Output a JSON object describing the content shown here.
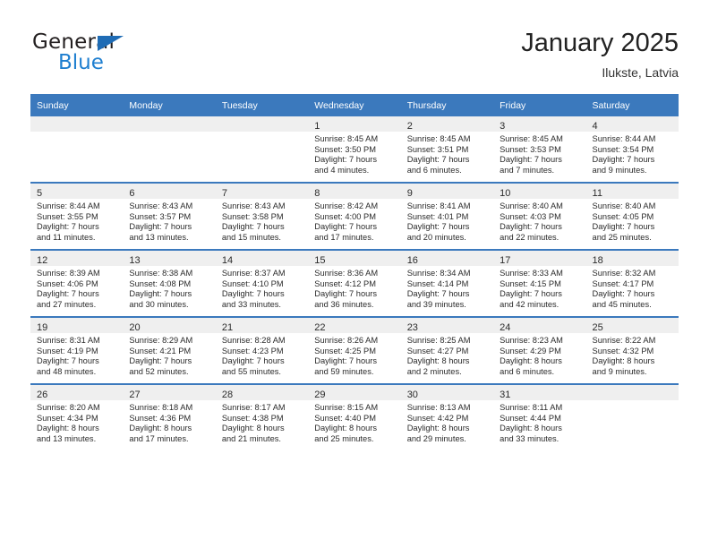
{
  "brand": {
    "name_part1": "General",
    "name_part2": "Blue",
    "triangle_color": "#1f6cb5",
    "blue_color": "#1f7fd0"
  },
  "header": {
    "title": "January 2025",
    "subtitle": "Ilukste, Latvia"
  },
  "theme": {
    "header_bg": "#3b79bd",
    "row_divider": "#3b79bd",
    "daynum_band": "#efefef"
  },
  "weekday_headers": [
    "Sunday",
    "Monday",
    "Tuesday",
    "Wednesday",
    "Thursday",
    "Friday",
    "Saturday"
  ],
  "labels": {
    "sunrise_prefix": "Sunrise:",
    "sunset_prefix": "Sunset:",
    "daylight_prefix": "Daylight:"
  },
  "weeks": [
    [
      {
        "empty": true
      },
      {
        "empty": true
      },
      {
        "empty": true
      },
      {
        "day": "1",
        "sunrise": "Sunrise: 8:45 AM",
        "sunset": "Sunset: 3:50 PM",
        "daylight_line1": "Daylight: 7 hours",
        "daylight_line2": "and 4 minutes."
      },
      {
        "day": "2",
        "sunrise": "Sunrise: 8:45 AM",
        "sunset": "Sunset: 3:51 PM",
        "daylight_line1": "Daylight: 7 hours",
        "daylight_line2": "and 6 minutes."
      },
      {
        "day": "3",
        "sunrise": "Sunrise: 8:45 AM",
        "sunset": "Sunset: 3:53 PM",
        "daylight_line1": "Daylight: 7 hours",
        "daylight_line2": "and 7 minutes."
      },
      {
        "day": "4",
        "sunrise": "Sunrise: 8:44 AM",
        "sunset": "Sunset: 3:54 PM",
        "daylight_line1": "Daylight: 7 hours",
        "daylight_line2": "and 9 minutes."
      }
    ],
    [
      {
        "day": "5",
        "sunrise": "Sunrise: 8:44 AM",
        "sunset": "Sunset: 3:55 PM",
        "daylight_line1": "Daylight: 7 hours",
        "daylight_line2": "and 11 minutes."
      },
      {
        "day": "6",
        "sunrise": "Sunrise: 8:43 AM",
        "sunset": "Sunset: 3:57 PM",
        "daylight_line1": "Daylight: 7 hours",
        "daylight_line2": "and 13 minutes."
      },
      {
        "day": "7",
        "sunrise": "Sunrise: 8:43 AM",
        "sunset": "Sunset: 3:58 PM",
        "daylight_line1": "Daylight: 7 hours",
        "daylight_line2": "and 15 minutes."
      },
      {
        "day": "8",
        "sunrise": "Sunrise: 8:42 AM",
        "sunset": "Sunset: 4:00 PM",
        "daylight_line1": "Daylight: 7 hours",
        "daylight_line2": "and 17 minutes."
      },
      {
        "day": "9",
        "sunrise": "Sunrise: 8:41 AM",
        "sunset": "Sunset: 4:01 PM",
        "daylight_line1": "Daylight: 7 hours",
        "daylight_line2": "and 20 minutes."
      },
      {
        "day": "10",
        "sunrise": "Sunrise: 8:40 AM",
        "sunset": "Sunset: 4:03 PM",
        "daylight_line1": "Daylight: 7 hours",
        "daylight_line2": "and 22 minutes."
      },
      {
        "day": "11",
        "sunrise": "Sunrise: 8:40 AM",
        "sunset": "Sunset: 4:05 PM",
        "daylight_line1": "Daylight: 7 hours",
        "daylight_line2": "and 25 minutes."
      }
    ],
    [
      {
        "day": "12",
        "sunrise": "Sunrise: 8:39 AM",
        "sunset": "Sunset: 4:06 PM",
        "daylight_line1": "Daylight: 7 hours",
        "daylight_line2": "and 27 minutes."
      },
      {
        "day": "13",
        "sunrise": "Sunrise: 8:38 AM",
        "sunset": "Sunset: 4:08 PM",
        "daylight_line1": "Daylight: 7 hours",
        "daylight_line2": "and 30 minutes."
      },
      {
        "day": "14",
        "sunrise": "Sunrise: 8:37 AM",
        "sunset": "Sunset: 4:10 PM",
        "daylight_line1": "Daylight: 7 hours",
        "daylight_line2": "and 33 minutes."
      },
      {
        "day": "15",
        "sunrise": "Sunrise: 8:36 AM",
        "sunset": "Sunset: 4:12 PM",
        "daylight_line1": "Daylight: 7 hours",
        "daylight_line2": "and 36 minutes."
      },
      {
        "day": "16",
        "sunrise": "Sunrise: 8:34 AM",
        "sunset": "Sunset: 4:14 PM",
        "daylight_line1": "Daylight: 7 hours",
        "daylight_line2": "and 39 minutes."
      },
      {
        "day": "17",
        "sunrise": "Sunrise: 8:33 AM",
        "sunset": "Sunset: 4:15 PM",
        "daylight_line1": "Daylight: 7 hours",
        "daylight_line2": "and 42 minutes."
      },
      {
        "day": "18",
        "sunrise": "Sunrise: 8:32 AM",
        "sunset": "Sunset: 4:17 PM",
        "daylight_line1": "Daylight: 7 hours",
        "daylight_line2": "and 45 minutes."
      }
    ],
    [
      {
        "day": "19",
        "sunrise": "Sunrise: 8:31 AM",
        "sunset": "Sunset: 4:19 PM",
        "daylight_line1": "Daylight: 7 hours",
        "daylight_line2": "and 48 minutes."
      },
      {
        "day": "20",
        "sunrise": "Sunrise: 8:29 AM",
        "sunset": "Sunset: 4:21 PM",
        "daylight_line1": "Daylight: 7 hours",
        "daylight_line2": "and 52 minutes."
      },
      {
        "day": "21",
        "sunrise": "Sunrise: 8:28 AM",
        "sunset": "Sunset: 4:23 PM",
        "daylight_line1": "Daylight: 7 hours",
        "daylight_line2": "and 55 minutes."
      },
      {
        "day": "22",
        "sunrise": "Sunrise: 8:26 AM",
        "sunset": "Sunset: 4:25 PM",
        "daylight_line1": "Daylight: 7 hours",
        "daylight_line2": "and 59 minutes."
      },
      {
        "day": "23",
        "sunrise": "Sunrise: 8:25 AM",
        "sunset": "Sunset: 4:27 PM",
        "daylight_line1": "Daylight: 8 hours",
        "daylight_line2": "and 2 minutes."
      },
      {
        "day": "24",
        "sunrise": "Sunrise: 8:23 AM",
        "sunset": "Sunset: 4:29 PM",
        "daylight_line1": "Daylight: 8 hours",
        "daylight_line2": "and 6 minutes."
      },
      {
        "day": "25",
        "sunrise": "Sunrise: 8:22 AM",
        "sunset": "Sunset: 4:32 PM",
        "daylight_line1": "Daylight: 8 hours",
        "daylight_line2": "and 9 minutes."
      }
    ],
    [
      {
        "day": "26",
        "sunrise": "Sunrise: 8:20 AM",
        "sunset": "Sunset: 4:34 PM",
        "daylight_line1": "Daylight: 8 hours",
        "daylight_line2": "and 13 minutes."
      },
      {
        "day": "27",
        "sunrise": "Sunrise: 8:18 AM",
        "sunset": "Sunset: 4:36 PM",
        "daylight_line1": "Daylight: 8 hours",
        "daylight_line2": "and 17 minutes."
      },
      {
        "day": "28",
        "sunrise": "Sunrise: 8:17 AM",
        "sunset": "Sunset: 4:38 PM",
        "daylight_line1": "Daylight: 8 hours",
        "daylight_line2": "and 21 minutes."
      },
      {
        "day": "29",
        "sunrise": "Sunrise: 8:15 AM",
        "sunset": "Sunset: 4:40 PM",
        "daylight_line1": "Daylight: 8 hours",
        "daylight_line2": "and 25 minutes."
      },
      {
        "day": "30",
        "sunrise": "Sunrise: 8:13 AM",
        "sunset": "Sunset: 4:42 PM",
        "daylight_line1": "Daylight: 8 hours",
        "daylight_line2": "and 29 minutes."
      },
      {
        "day": "31",
        "sunrise": "Sunrise: 8:11 AM",
        "sunset": "Sunset: 4:44 PM",
        "daylight_line1": "Daylight: 8 hours",
        "daylight_line2": "and 33 minutes."
      },
      {
        "empty": true
      }
    ]
  ]
}
